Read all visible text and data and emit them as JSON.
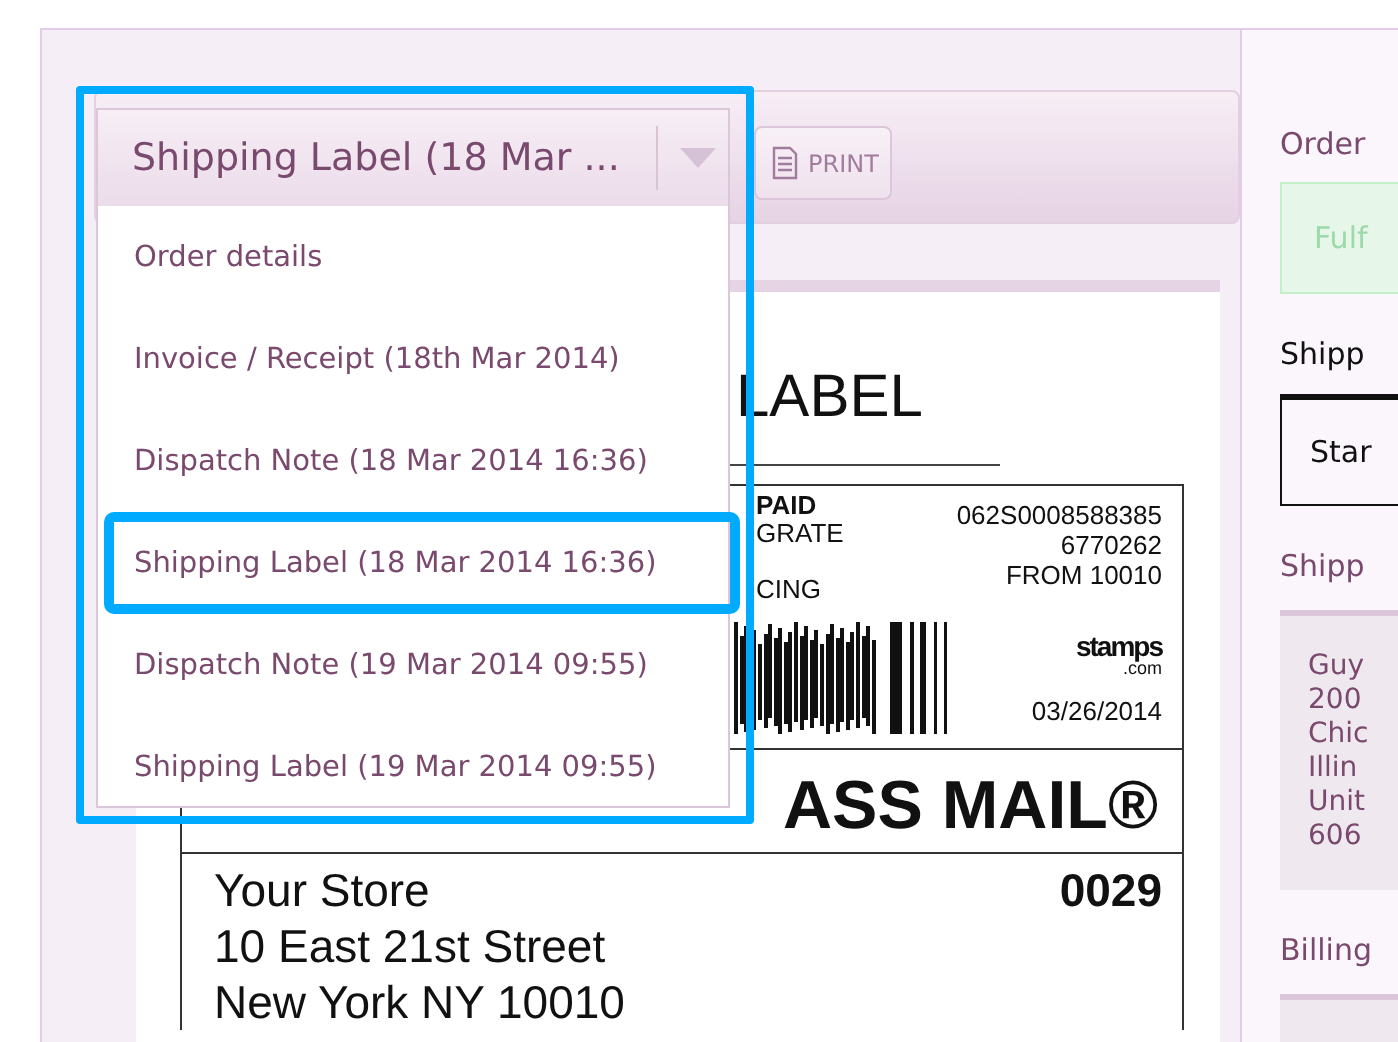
{
  "dropdown": {
    "value": "Shipping Label (18 Mar ...",
    "options": [
      {
        "label": "Order details",
        "selected": false
      },
      {
        "label": "Invoice / Receipt (18th Mar 2014)",
        "selected": false
      },
      {
        "label": "Dispatch Note (18 Mar 2014 16:36)",
        "selected": false
      },
      {
        "label": "Shipping Label (18 Mar 2014 16:36)",
        "selected": true
      },
      {
        "label": "Dispatch Note (19 Mar 2014 09:55)",
        "selected": false
      },
      {
        "label": "Shipping Label (19 Mar 2014 09:55)",
        "selected": false
      }
    ]
  },
  "toolbar": {
    "print_button": "PRINT"
  },
  "label": {
    "heading": "LABEL",
    "postage_lines": [
      "PAID",
      "GRATE",
      "CING"
    ],
    "tracking_lines": [
      "062S0008588385",
      "6770262",
      "FROM 10010"
    ],
    "logo": "stamps",
    "logo_suffix": ".com",
    "date": "03/26/2014",
    "service": "ASS MAIL®",
    "sender_lines": [
      "Your Store",
      "10 East 21st Street",
      "New York NY 10010"
    ],
    "route_code": "0029"
  },
  "sidebar": {
    "order_heading": "Order",
    "status_button": "Fulf",
    "shipping_heading": "Shipp",
    "shipping_method": "Star",
    "address_heading": "Shipp",
    "address_lines": [
      "Guy",
      "200",
      "Chic",
      "Illin",
      "Unit",
      "606"
    ],
    "billing_heading": "Billing"
  }
}
